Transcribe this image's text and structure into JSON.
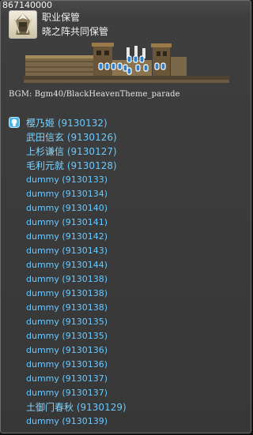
{
  "header": {
    "map_id": "867140000",
    "line1": "职业保管",
    "line2": "晓之阵共同保管"
  },
  "bgm": "BGM: Bgm40/BlackHeavenTheme_parade",
  "list": [
    {
      "name": "樱乃姬",
      "id": "(9130132)",
      "type": "named",
      "icon": "npc-bubble-icon"
    },
    {
      "name": "武田信玄",
      "id": "(9130126)",
      "type": "named"
    },
    {
      "name": "上杉谦信",
      "id": "(9130127)",
      "type": "named"
    },
    {
      "name": "毛利元就",
      "id": "(9130128)",
      "type": "named"
    },
    {
      "name": "dummy",
      "id": "(9130133)",
      "type": "dummy"
    },
    {
      "name": "dummy",
      "id": "(9130134)",
      "type": "dummy"
    },
    {
      "name": "dummy",
      "id": "(9130140)",
      "type": "dummy"
    },
    {
      "name": "dummy",
      "id": "(9130141)",
      "type": "dummy"
    },
    {
      "name": "dummy",
      "id": "(9130142)",
      "type": "dummy"
    },
    {
      "name": "dummy",
      "id": "(9130143)",
      "type": "dummy"
    },
    {
      "name": "dummy",
      "id": "(9130144)",
      "type": "dummy"
    },
    {
      "name": "dummy",
      "id": "(9130138)",
      "type": "dummy"
    },
    {
      "name": "dummy",
      "id": "(9130138)",
      "type": "dummy"
    },
    {
      "name": "dummy",
      "id": "(9130138)",
      "type": "dummy"
    },
    {
      "name": "dummy",
      "id": "(9130135)",
      "type": "dummy"
    },
    {
      "name": "dummy",
      "id": "(9130135)",
      "type": "dummy"
    },
    {
      "name": "dummy",
      "id": "(9130136)",
      "type": "dummy"
    },
    {
      "name": "dummy",
      "id": "(9130136)",
      "type": "dummy"
    },
    {
      "name": "dummy",
      "id": "(9130137)",
      "type": "dummy"
    },
    {
      "name": "dummy",
      "id": "(9130137)",
      "type": "dummy"
    },
    {
      "name": "土御门春秋",
      "id": "(9130129)",
      "type": "named"
    },
    {
      "name": "dummy",
      "id": "(9130139)",
      "type": "dummy"
    }
  ],
  "colors": {
    "link": "#69c9ff",
    "panel_bg": "#393939",
    "text": "#f2f2f2"
  }
}
